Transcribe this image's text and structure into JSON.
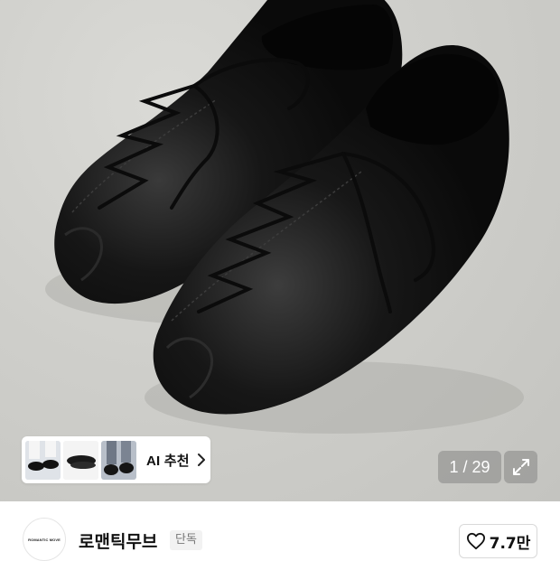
{
  "gallery": {
    "current": "1",
    "total": "29",
    "counter_text": "1 / 29"
  },
  "ai_recommend": {
    "label": "AI 추천",
    "thumbnails": [
      "shoe-thumbnail",
      "shoe-thumbnail",
      "shoe-thumbnail"
    ]
  },
  "brand": {
    "logo_text": "ROMANTIC MOVE",
    "name": "로맨틱무브",
    "badge": "단독"
  },
  "like": {
    "count": "7.7만",
    "icon": "heart-icon"
  },
  "colors": {
    "hero_bg": "#cfcfcb",
    "shoe": "#111111",
    "counter_bg": "rgba(120,120,120,0.45)"
  }
}
